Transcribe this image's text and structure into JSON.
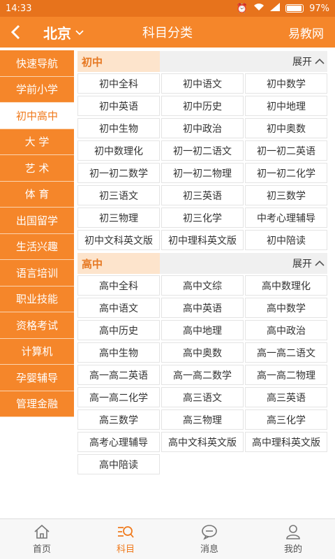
{
  "status": {
    "time": "14:33",
    "battery": "97%"
  },
  "header": {
    "city": "北京",
    "title": "科目分类",
    "brand": "易教网"
  },
  "sidebar": {
    "items": [
      {
        "label": "快速导航"
      },
      {
        "label": "学前小学"
      },
      {
        "label": "初中高中",
        "active": true
      },
      {
        "label": "大 学"
      },
      {
        "label": "艺 术"
      },
      {
        "label": "体 育"
      },
      {
        "label": "出国留学"
      },
      {
        "label": "生活兴趣"
      },
      {
        "label": "语言培训"
      },
      {
        "label": "职业技能"
      },
      {
        "label": "资格考试"
      },
      {
        "label": "计算机"
      },
      {
        "label": "孕婴辅导"
      },
      {
        "label": "管理金融"
      }
    ]
  },
  "sections": [
    {
      "title": "初中",
      "expand": "展开",
      "items": [
        "初中全科",
        "初中语文",
        "初中数学",
        "初中英语",
        "初中历史",
        "初中地理",
        "初中生物",
        "初中政治",
        "初中奥数",
        "初中数理化",
        "初一初二语文",
        "初一初二英语",
        "初一初二数学",
        "初一初二物理",
        "初一初二化学",
        "初三语文",
        "初三英语",
        "初三数学",
        "初三物理",
        "初三化学",
        "中考心理辅导",
        "初中文科英文版",
        "初中理科英文版",
        "初中陪读"
      ]
    },
    {
      "title": "高中",
      "expand": "展开",
      "items": [
        "高中全科",
        "高中文综",
        "高中数理化",
        "高中语文",
        "高中英语",
        "高中数学",
        "高中历史",
        "高中地理",
        "高中政治",
        "高中生物",
        "高中奥数",
        "高一高二语文",
        "高一高二英语",
        "高一高二数学",
        "高一高二物理",
        "高一高二化学",
        "高三语文",
        "高三英语",
        "高三数学",
        "高三物理",
        "高三化学",
        "高考心理辅导",
        "高中文科英文版",
        "高中理科英文版",
        "高中陪读"
      ]
    }
  ],
  "tabs": [
    {
      "label": "首页",
      "icon": "home-icon"
    },
    {
      "label": "科目",
      "icon": "subject-icon",
      "active": true
    },
    {
      "label": "消息",
      "icon": "message-icon"
    },
    {
      "label": "我的",
      "icon": "user-icon"
    }
  ],
  "colors": {
    "accent": "#f5862a",
    "accent_text": "#f07a1c",
    "section_bg": "#fde4cc"
  }
}
